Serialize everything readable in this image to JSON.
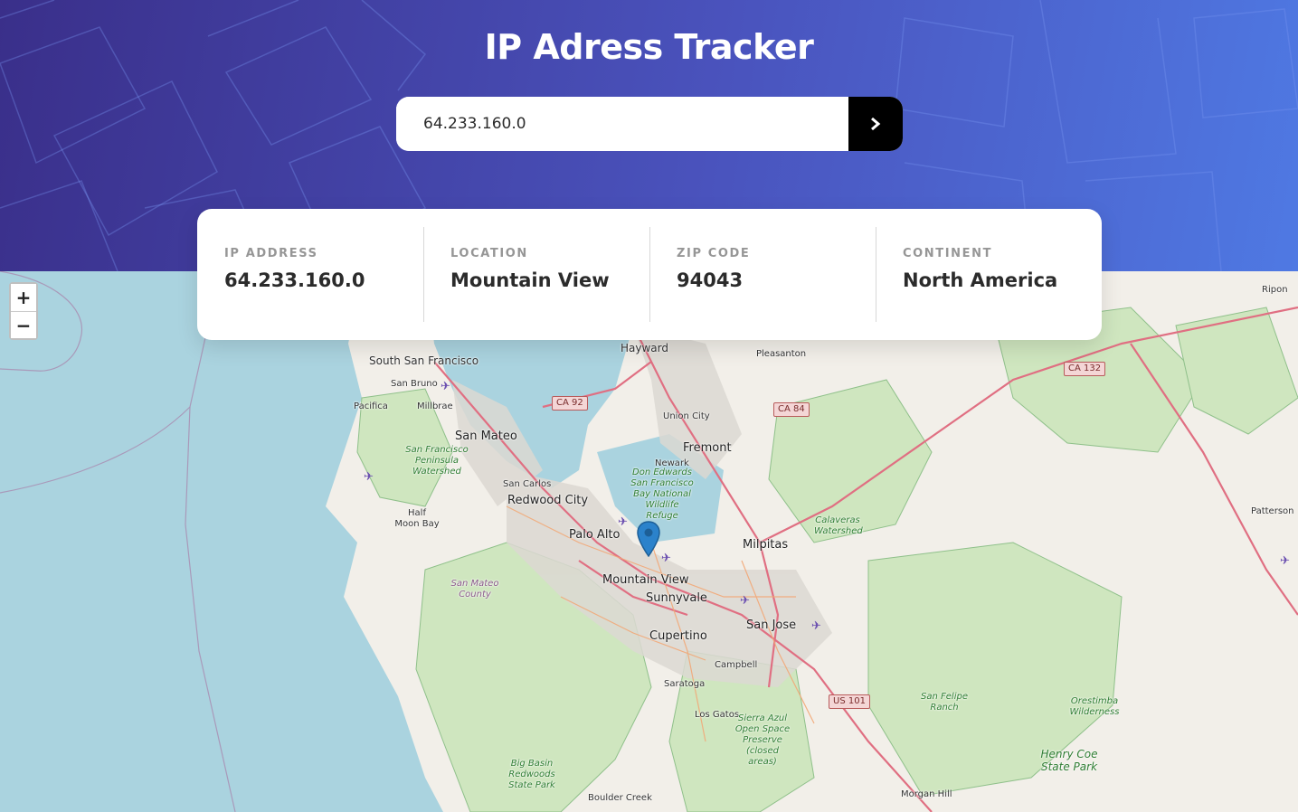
{
  "header": {
    "title": "IP Adress Tracker",
    "search_value": "64.233.160.0",
    "submit_icon": "chevron-right-icon"
  },
  "info": {
    "ip_label": "IP ADDRESS",
    "ip_value": "64.233.160.0",
    "location_label": "LOCATION",
    "location_value": "Mountain View",
    "zip_label": "ZIP CODE",
    "zip_value": "94043",
    "continent_label": "CONTINENT",
    "continent_value": "North America"
  },
  "map": {
    "zoom_in": "+",
    "zoom_out": "−",
    "marker_icon": "map-pin-icon",
    "places": {
      "hayward": "Hayward",
      "pleasanton": "Pleasanton",
      "south_sf": "South San Francisco",
      "san_bruno": "San Bruno",
      "pacifica": "Pacifica",
      "millbrae": "Millbrae",
      "san_mateo": "San Mateo",
      "union_city": "Union City",
      "fremont": "Fremont",
      "newark": "Newark",
      "san_carlos": "San Carlos",
      "redwood_city": "Redwood City",
      "half_moon_bay": "Half Moon Bay",
      "palo_alto": "Palo Alto",
      "milpitas": "Milpitas",
      "mountain_view": "Mountain View",
      "sunnyvale": "Sunnyvale",
      "san_jose": "San Jose",
      "cupertino": "Cupertino",
      "campbell": "Campbell",
      "saratoga": "Saratoga",
      "los_gatos": "Los Gatos",
      "boulder_creek": "Boulder Creek",
      "morgan_hill": "Morgan Hill",
      "patterson": "Patterson",
      "ripon": "Ripon"
    },
    "parks": {
      "sf_watershed": "San Francisco Peninsula Watershed",
      "don_edwards": "Don Edwards San Francisco Bay National Wildlife Refuge",
      "calaveras": "Calaveras Watershed",
      "sierra_azul": "Sierra Azul Open Space Preserve (closed areas)",
      "big_basin": "Big Basin Redwoods State Park",
      "san_felipe": "San Felipe Ranch",
      "orestimba": "Orestimba Wilderness",
      "henry_coe": "Henry Coe State Park",
      "san_mateo_county": "San Mateo County"
    },
    "shields": {
      "ca92": "CA 92",
      "ca84": "CA 84",
      "ca132": "CA 132",
      "us101": "US 101"
    }
  }
}
